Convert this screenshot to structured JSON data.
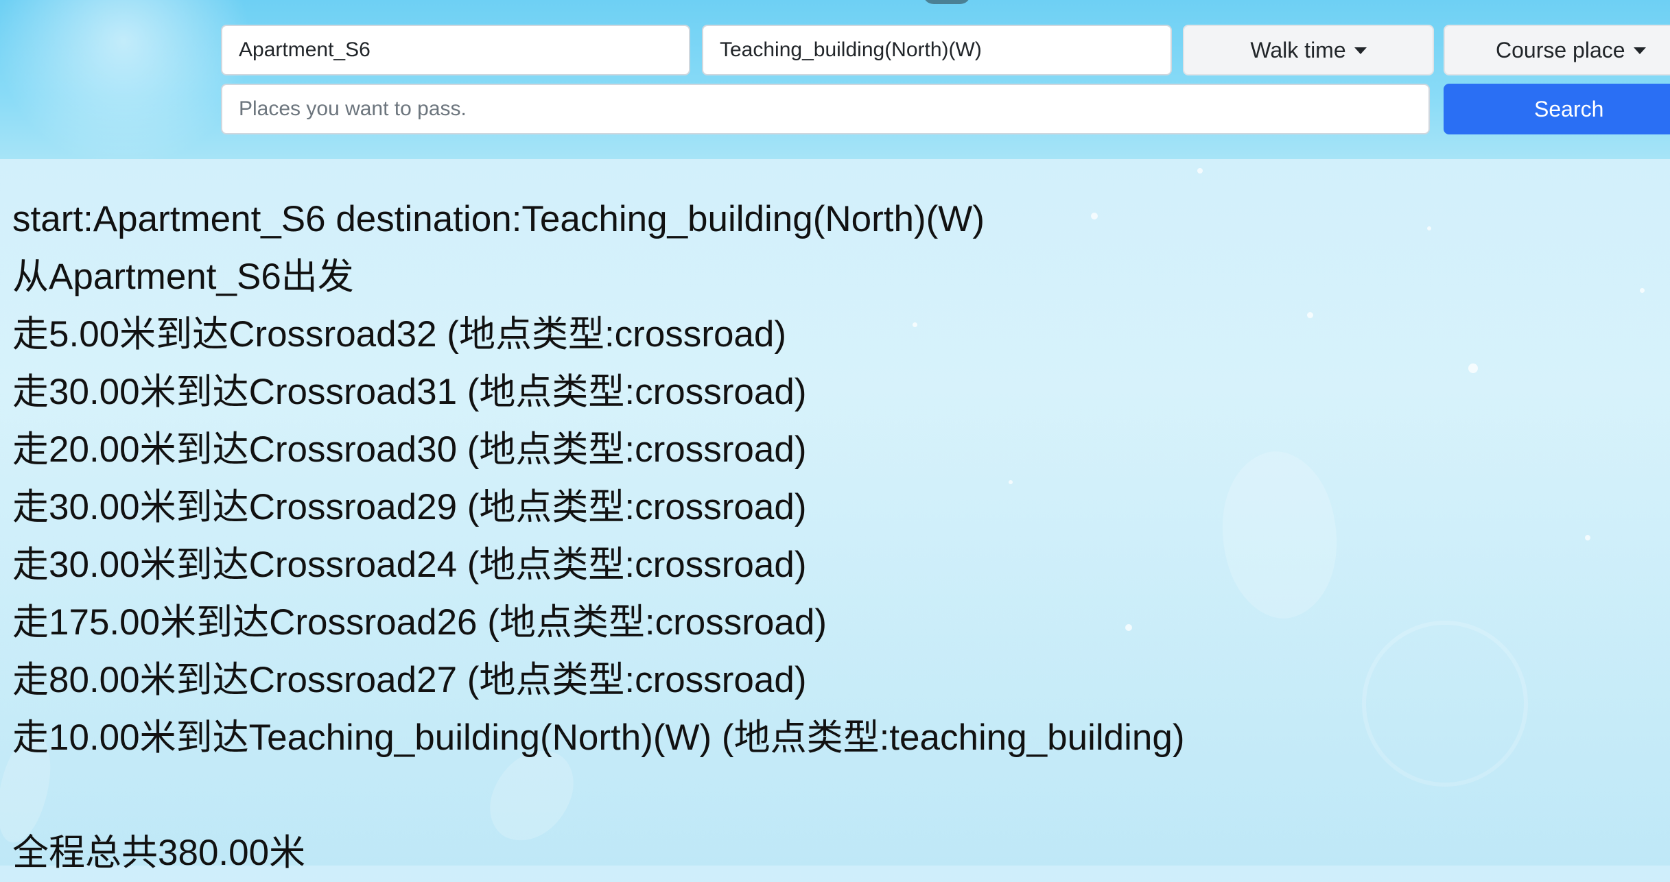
{
  "search": {
    "start_value": "Apartment_S6",
    "destination_value": "Teaching_building(North)(W)",
    "pass_placeholder": "Places you want to pass.",
    "strategy_label": "Walk time",
    "course_label": "Course place",
    "search_label": "Search"
  },
  "route": {
    "header": "start:Apartment_S6 destination:Teaching_building(North)(W)",
    "depart": "从Apartment_S6出发",
    "steps": [
      "走5.00米到达Crossroad32 (地点类型:crossroad)",
      "走30.00米到达Crossroad31 (地点类型:crossroad)",
      "走20.00米到达Crossroad30 (地点类型:crossroad)",
      "走30.00米到达Crossroad29 (地点类型:crossroad)",
      "走30.00米到达Crossroad24 (地点类型:crossroad)",
      "走175.00米到达Crossroad26 (地点类型:crossroad)",
      "走80.00米到达Crossroad27 (地点类型:crossroad)",
      "走10.00米到达Teaching_building(North)(W) (地点类型:teaching_building)"
    ],
    "total": "全程总共380.00米"
  },
  "colors": {
    "primary": "#2a6ff4",
    "header_bg": "#89dbf7",
    "page_bg": "#d7f2fb"
  }
}
